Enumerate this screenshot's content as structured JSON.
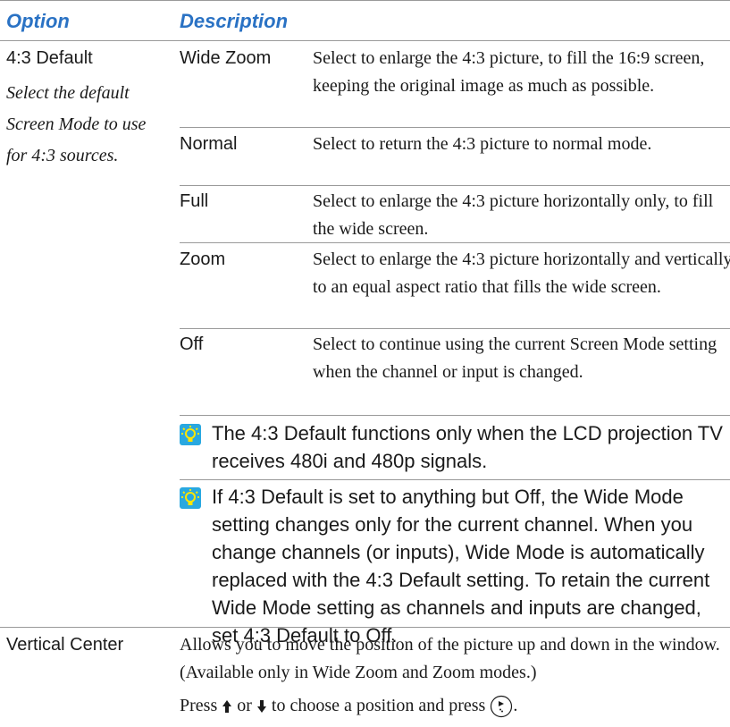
{
  "header": {
    "option": "Option",
    "description": "Description"
  },
  "option": {
    "name": "4:3 Default",
    "description": "Select the default Screen Mode to use for 4:3 sources."
  },
  "modes": [
    {
      "name": "Wide Zoom",
      "desc": "Select to enlarge the 4:3 picture, to fill the 16:9 screen, keeping the original image as much as possible."
    },
    {
      "name": "Normal",
      "desc": "Select to return the 4:3 picture to normal mode."
    },
    {
      "name": "Full",
      "desc": "Select to enlarge the 4:3 picture horizontally only, to fill the wide screen."
    },
    {
      "name": "Zoom",
      "desc": "Select to enlarge the 4:3 picture horizontally and vertically to an equal aspect ratio that fills the wide screen."
    },
    {
      "name": "Off",
      "desc": "Select to continue using the current Screen Mode setting when the channel or input is changed."
    }
  ],
  "tips": [
    "The 4:3 Default functions only when the LCD projection TV receives 480i and 480p signals.",
    "If 4:3 Default is set to anything but Off, the Wide Mode setting changes only for the current channel. When you change channels (or inputs), Wide Mode is automatically replaced with the 4:3 Default setting. To retain the current Wide Mode setting as channels and inputs are changed, set 4:3 Default to Off."
  ],
  "vertical_center": {
    "name": "Vertical Center",
    "desc": "Allows you to move the position of the picture up and down in the window. (Available only in Wide Zoom and Zoom modes.)",
    "press_prefix": "Press",
    "press_or": "or",
    "press_suffix": "to choose a position and press",
    "press_end": "."
  },
  "icons": [
    "tip-icon",
    "up-arrow-icon",
    "down-arrow-icon",
    "select-button-icon"
  ],
  "colors": {
    "header": "#2a72c4",
    "tip_icon_bg": "#29a8e0",
    "tip_icon_glyph": "#ffe600",
    "rule": "#9a9a9a"
  }
}
